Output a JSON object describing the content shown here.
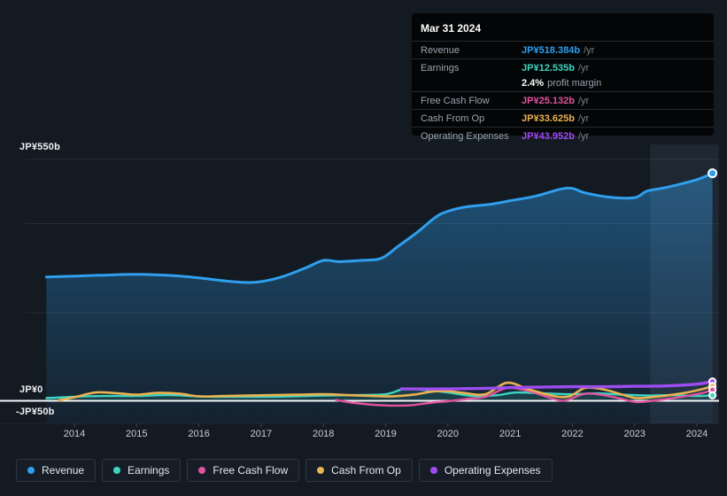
{
  "chart_data": {
    "type": "line",
    "title": "",
    "x_axis": {
      "ticks": [
        "2014",
        "2015",
        "2016",
        "2017",
        "2018",
        "2019",
        "2020",
        "2021",
        "2022",
        "2023",
        "2024"
      ],
      "range": [
        2013.4,
        2024.45
      ]
    },
    "y_axis": {
      "labels": [
        "JP¥550b",
        "JP¥0",
        "-JP¥50b"
      ],
      "ylim": [
        -50,
        550
      ],
      "unit": "JP¥ billions per year"
    },
    "legend_position": "bottom",
    "grid": "horizontal-faint",
    "highlight_band_years": [
      2023.25,
      2024.35
    ],
    "series": [
      {
        "name": "Revenue",
        "color": "#2f9fee",
        "area": "gradient",
        "points": [
          [
            2013.55,
            282
          ],
          [
            2014.0,
            284
          ],
          [
            2014.4,
            286
          ],
          [
            2015.0,
            288
          ],
          [
            2015.6,
            285
          ],
          [
            2016.0,
            280
          ],
          [
            2016.5,
            272
          ],
          [
            2016.9,
            270
          ],
          [
            2017.3,
            281
          ],
          [
            2017.7,
            302
          ],
          [
            2018.0,
            320
          ],
          [
            2018.25,
            317
          ],
          [
            2018.6,
            320
          ],
          [
            2018.85,
            322
          ],
          [
            2019.0,
            330
          ],
          [
            2019.2,
            352
          ],
          [
            2019.5,
            383
          ],
          [
            2019.8,
            418
          ],
          [
            2020.0,
            432
          ],
          [
            2020.3,
            442
          ],
          [
            2020.7,
            448
          ],
          [
            2021.0,
            456
          ],
          [
            2021.4,
            466
          ],
          [
            2021.8,
            482
          ],
          [
            2022.0,
            484
          ],
          [
            2022.2,
            474
          ],
          [
            2022.6,
            464
          ],
          [
            2023.0,
            463
          ],
          [
            2023.2,
            478
          ],
          [
            2023.5,
            486
          ],
          [
            2024.0,
            504
          ],
          [
            2024.25,
            518.4
          ]
        ]
      },
      {
        "name": "Earnings",
        "color": "#3fd4c0",
        "area": "flat",
        "points": [
          [
            2013.55,
            6
          ],
          [
            2014.0,
            9
          ],
          [
            2014.5,
            11
          ],
          [
            2015.0,
            11
          ],
          [
            2015.5,
            13
          ],
          [
            2016.0,
            10
          ],
          [
            2016.5,
            9
          ],
          [
            2017.0,
            9
          ],
          [
            2017.5,
            10
          ],
          [
            2018.0,
            12
          ],
          [
            2018.5,
            13
          ],
          [
            2019.0,
            15
          ],
          [
            2019.3,
            27
          ],
          [
            2019.6,
            25
          ],
          [
            2020.0,
            19
          ],
          [
            2020.4,
            11
          ],
          [
            2020.8,
            13
          ],
          [
            2021.1,
            19
          ],
          [
            2021.5,
            17
          ],
          [
            2022.0,
            15
          ],
          [
            2022.4,
            17
          ],
          [
            2022.8,
            14
          ],
          [
            2023.2,
            12
          ],
          [
            2023.6,
            13
          ],
          [
            2024.0,
            11
          ],
          [
            2024.25,
            12.5
          ]
        ]
      },
      {
        "name": "Free Cash Flow",
        "color": "#e0539e",
        "area": "none",
        "points": [
          [
            2018.2,
            2
          ],
          [
            2018.45,
            -4
          ],
          [
            2018.8,
            -9
          ],
          [
            2019.1,
            -11
          ],
          [
            2019.4,
            -10
          ],
          [
            2019.75,
            -4
          ],
          [
            2020.0,
            -1
          ],
          [
            2020.3,
            4
          ],
          [
            2020.6,
            9
          ],
          [
            2020.95,
            29
          ],
          [
            2021.3,
            22
          ],
          [
            2021.7,
            4
          ],
          [
            2021.9,
            1
          ],
          [
            2022.2,
            16
          ],
          [
            2022.5,
            13
          ],
          [
            2022.8,
            4
          ],
          [
            2023.05,
            -3
          ],
          [
            2023.4,
            2
          ],
          [
            2023.8,
            10
          ],
          [
            2024.1,
            18
          ],
          [
            2024.25,
            25.1
          ]
        ]
      },
      {
        "name": "Cash From Op",
        "color": "#eab251",
        "area": "none",
        "points": [
          [
            2013.75,
            1
          ],
          [
            2014.0,
            8
          ],
          [
            2014.35,
            19
          ],
          [
            2014.7,
            17
          ],
          [
            2015.0,
            14
          ],
          [
            2015.35,
            18
          ],
          [
            2015.7,
            16
          ],
          [
            2016.0,
            10
          ],
          [
            2016.4,
            11
          ],
          [
            2016.8,
            12
          ],
          [
            2017.2,
            13
          ],
          [
            2017.6,
            14
          ],
          [
            2018.0,
            15
          ],
          [
            2018.4,
            13
          ],
          [
            2018.8,
            11
          ],
          [
            2019.1,
            10
          ],
          [
            2019.45,
            14
          ],
          [
            2019.75,
            21
          ],
          [
            2020.0,
            22
          ],
          [
            2020.25,
            18
          ],
          [
            2020.6,
            15
          ],
          [
            2020.95,
            41
          ],
          [
            2021.3,
            26
          ],
          [
            2021.7,
            11
          ],
          [
            2021.95,
            10
          ],
          [
            2022.2,
            29
          ],
          [
            2022.5,
            26
          ],
          [
            2022.85,
            12
          ],
          [
            2023.05,
            6
          ],
          [
            2023.4,
            10
          ],
          [
            2023.8,
            18
          ],
          [
            2024.1,
            27
          ],
          [
            2024.25,
            33.6
          ]
        ]
      },
      {
        "name": "Operating Expenses",
        "color": "#9e4cf0",
        "area": "none",
        "points": [
          [
            2019.25,
            27
          ],
          [
            2020.0,
            27
          ],
          [
            2020.5,
            28
          ],
          [
            2021.0,
            30
          ],
          [
            2021.5,
            31
          ],
          [
            2022.0,
            32
          ],
          [
            2022.5,
            32
          ],
          [
            2023.0,
            33
          ],
          [
            2023.5,
            34
          ],
          [
            2024.0,
            38
          ],
          [
            2024.25,
            44
          ]
        ]
      }
    ]
  },
  "tooltip": {
    "title": "Mar 31 2024",
    "rows": [
      {
        "label": "Revenue",
        "value": "JP¥518.384b",
        "suffix": "/yr",
        "series_index": 0
      },
      {
        "label": "Earnings",
        "value": "JP¥12.535b",
        "suffix": "/yr",
        "series_index": 1
      },
      {
        "label": "Free Cash Flow",
        "value": "JP¥25.132b",
        "suffix": "/yr",
        "series_index": 2
      },
      {
        "label": "Cash From Op",
        "value": "JP¥33.625b",
        "suffix": "/yr",
        "series_index": 3
      },
      {
        "label": "Operating Expenses",
        "value": "JP¥43.952b",
        "suffix": "/yr",
        "series_index": 4
      }
    ],
    "margin": {
      "value": "2.4%",
      "label": "profit margin"
    }
  }
}
